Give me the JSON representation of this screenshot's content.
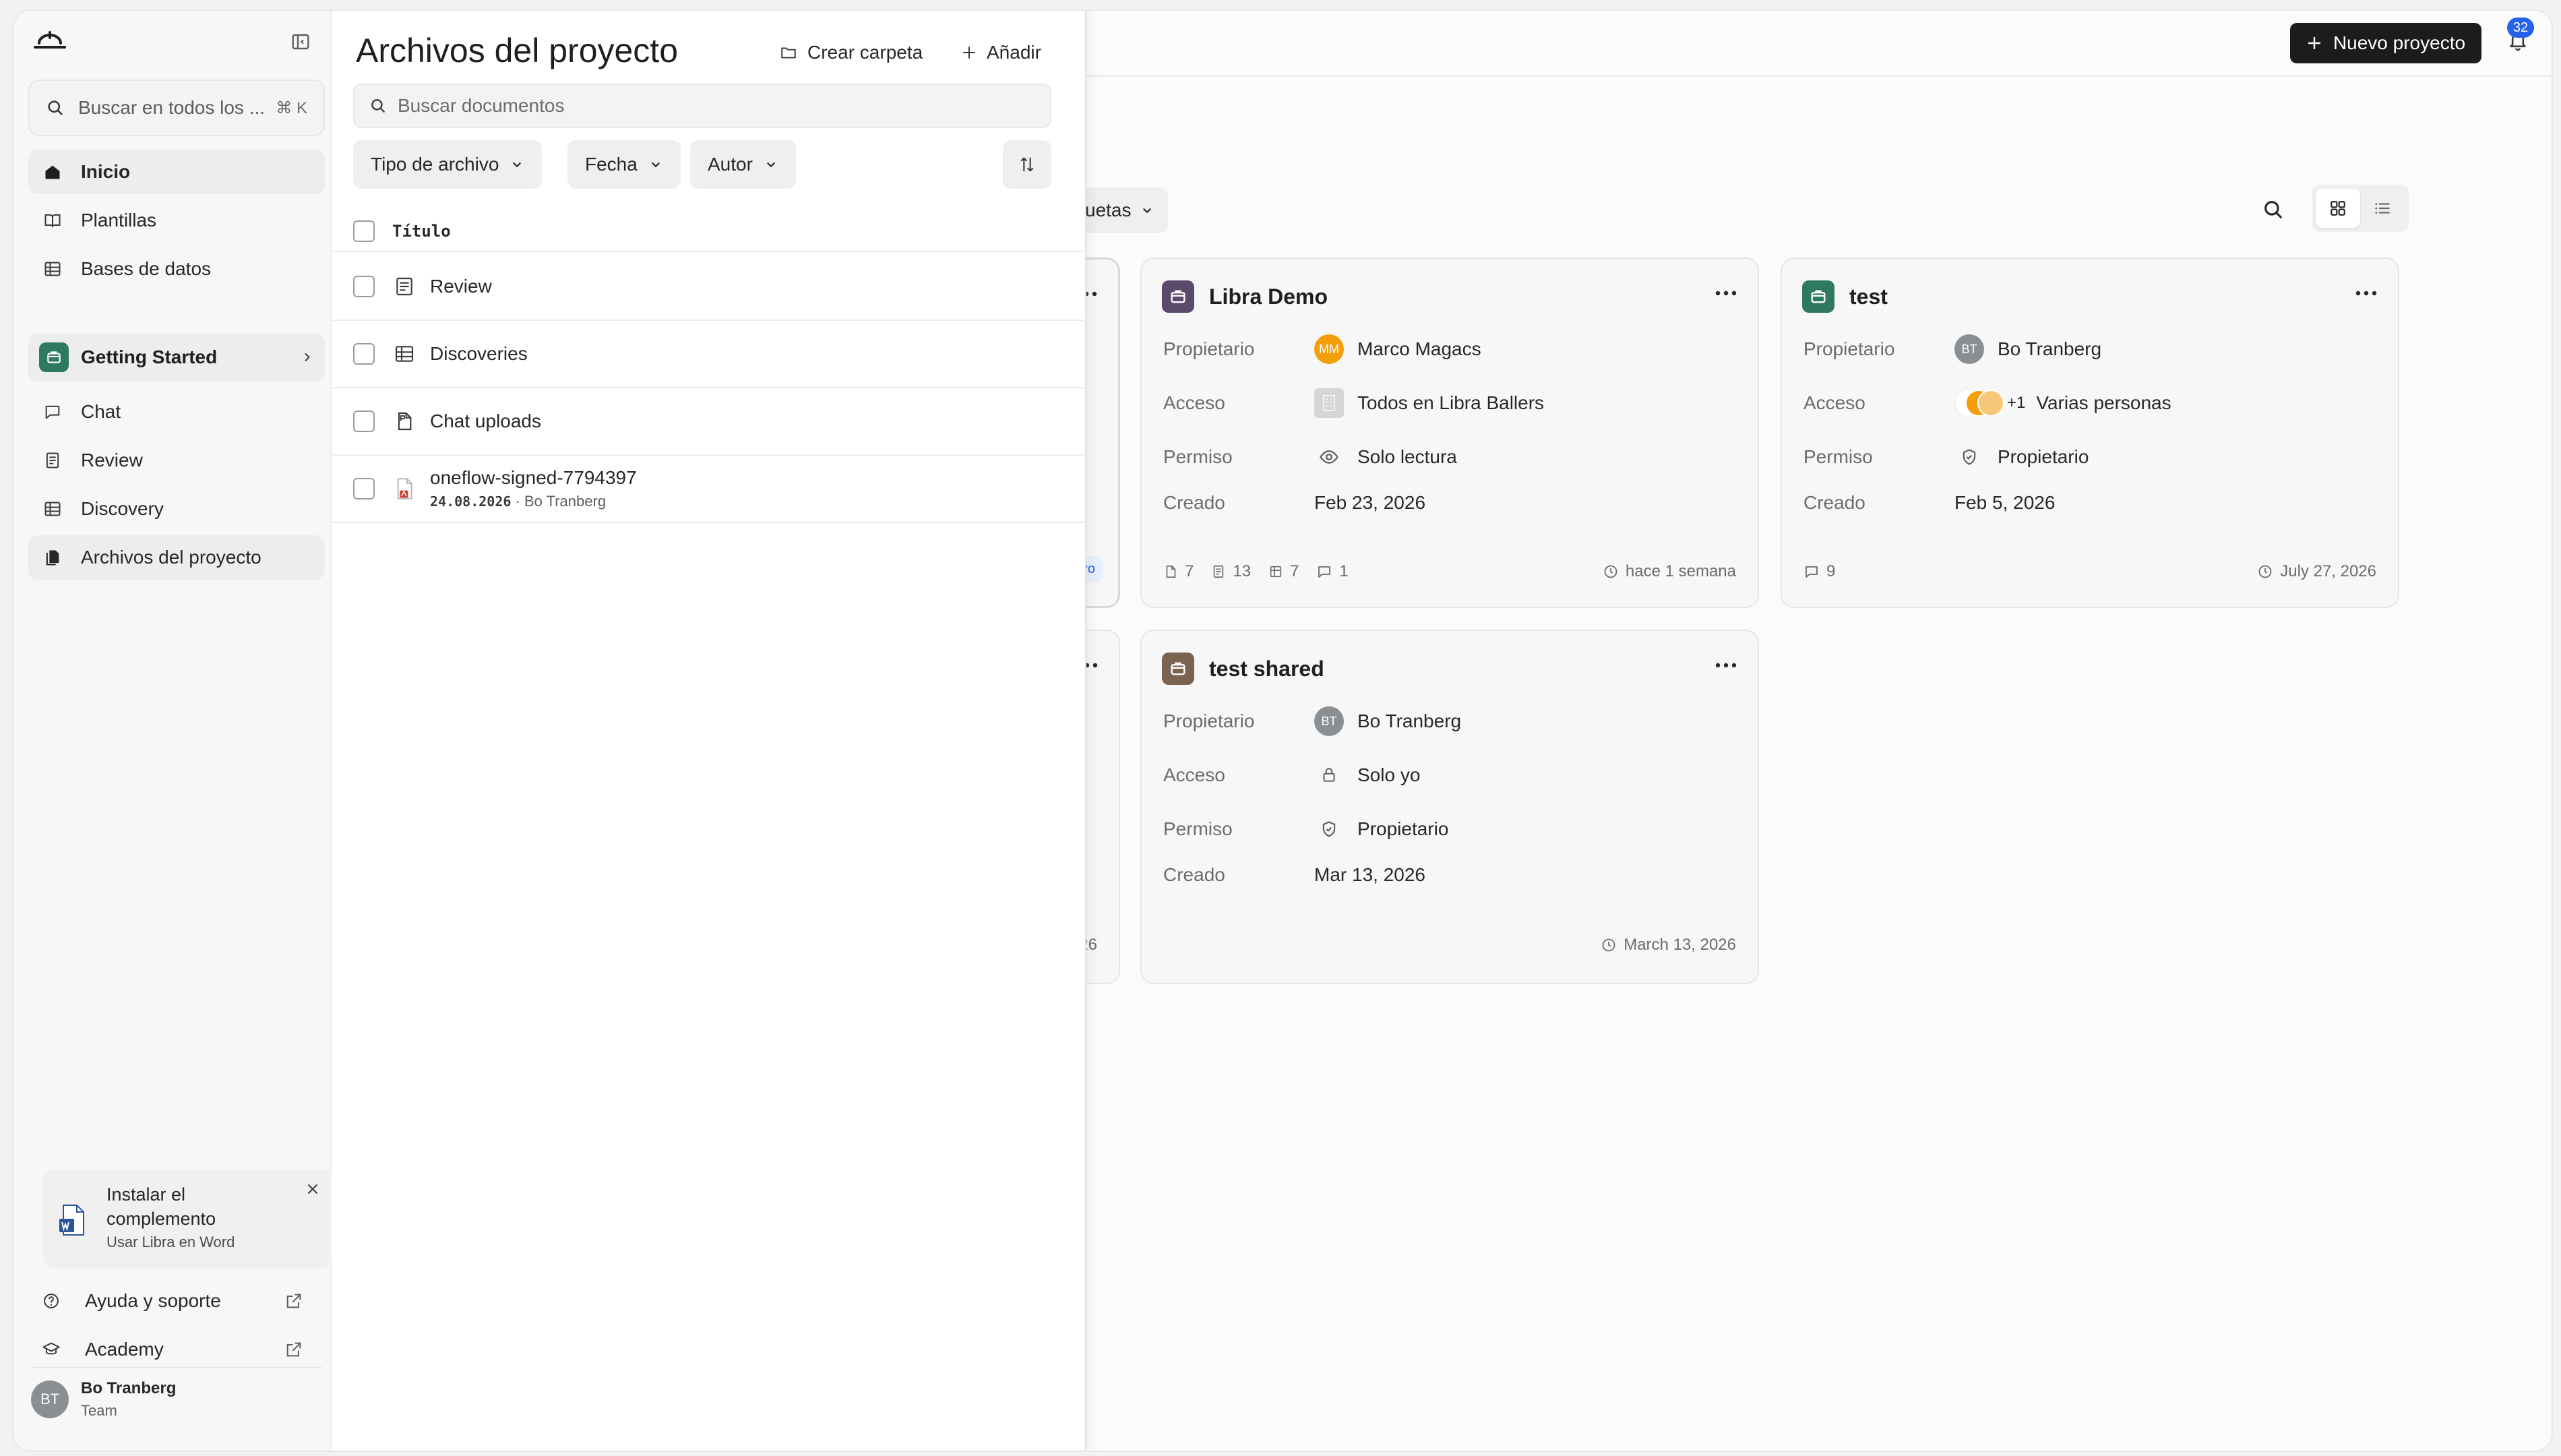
{
  "sidebar": {
    "search_placeholder": "Buscar en todos los ...",
    "search_shortcut": "⌘ K",
    "nav": [
      {
        "label": "Inicio",
        "icon": "home-icon"
      },
      {
        "label": "Plantillas",
        "icon": "book-icon"
      },
      {
        "label": "Bases de datos",
        "icon": "table-icon"
      }
    ],
    "project": {
      "label": "Getting Started",
      "color": "#2f7a5e"
    },
    "project_nav": [
      {
        "label": "Chat",
        "icon": "chat-icon"
      },
      {
        "label": "Review",
        "icon": "review-icon"
      },
      {
        "label": "Discovery",
        "icon": "table-icon"
      },
      {
        "label": "Archivos del proyecto",
        "icon": "files-icon"
      }
    ],
    "promo": {
      "title": "Instalar el complemento",
      "subtitle": "Usar Libra en Word"
    },
    "help": "Ayuda y soporte",
    "academy": "Academy",
    "user": {
      "initials": "BT",
      "name": "Bo Tranberg",
      "team": "Team"
    }
  },
  "topbar": {
    "new_project": "Nuevo proyecto",
    "notifications": "32"
  },
  "toolbar": {
    "tags_filter": "uetas"
  },
  "cards": [
    {
      "name": "Libra Demo",
      "color": "#5b4a6b",
      "owner_label": "Propietario",
      "owner": "Marco Magacs",
      "owner_initials": "MM",
      "owner_color": "#f59e0b",
      "access_label": "Acceso",
      "access": "Todos en Libra Ballers",
      "perm_label": "Permiso",
      "perm": "Solo lectura",
      "created_label": "Creado",
      "created": "Feb 23, 2026",
      "stats": [
        "7",
        "13",
        "7",
        "1"
      ],
      "updated": "hace 1 semana"
    },
    {
      "name": "test",
      "color": "#2f7a5e",
      "owner_label": "Propietario",
      "owner": "Bo Tranberg",
      "owner_initials": "BT",
      "owner_color": "#8a8f94",
      "access_label": "Acceso",
      "access": "Varias personas",
      "access_extra": "+1",
      "perm_label": "Permiso",
      "perm": "Propietario",
      "created_label": "Creado",
      "created": "Feb 5, 2026",
      "stats": [
        "9"
      ],
      "updated": "July 27, 2026"
    },
    {
      "name": "test shared",
      "color": "#7a6450",
      "owner_label": "Propietario",
      "owner": "Bo Tranberg",
      "owner_initials": "BT",
      "owner_color": "#8a8f94",
      "access_label": "Acceso",
      "access": "Solo yo",
      "perm_label": "Permiso",
      "perm": "Propietario",
      "created_label": "Creado",
      "created": "Mar 13, 2026",
      "updated": "March 13, 2026"
    }
  ],
  "partial_cards": {
    "badge": "vo",
    "date": "026"
  },
  "panel": {
    "title": "Archivos del proyecto",
    "create_folder": "Crear carpeta",
    "add": "Añadir",
    "search_placeholder": "Buscar documentos",
    "filters": [
      "Tipo de archivo",
      "Fecha",
      "Autor"
    ],
    "column_title": "Título",
    "files": [
      {
        "name": "Review",
        "icon": "review-icon"
      },
      {
        "name": "Discoveries",
        "icon": "table-icon"
      },
      {
        "name": "Chat uploads",
        "icon": "chat-doc-icon"
      },
      {
        "name": "oneflow-signed-7794397",
        "icon": "pdf-icon",
        "date": "24.08.2026",
        "author": "· Bo Tranberg"
      }
    ]
  }
}
